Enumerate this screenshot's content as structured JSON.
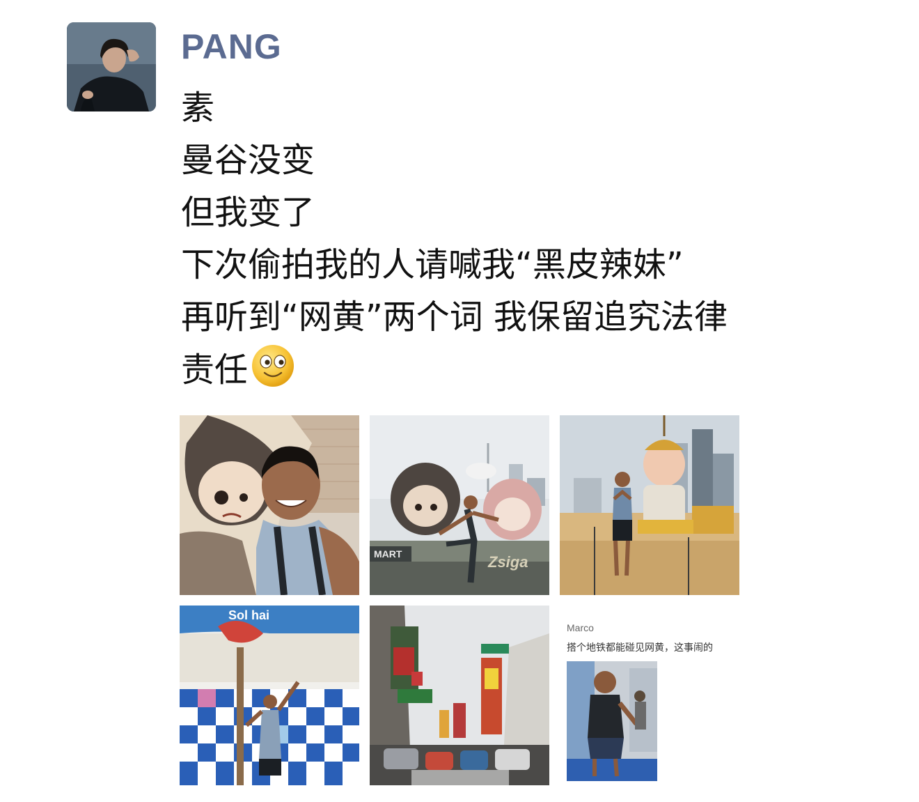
{
  "post": {
    "username": "PANG",
    "lines": [
      "素",
      "曼谷没变",
      "但我变了",
      "下次偷拍我的人请喊我“黑皮辣妹”",
      "再听到“网黄”两个词 我保留追究法律",
      "责任"
    ],
    "emoji": "smile-icon"
  },
  "photos": {
    "p6_caption_name": "Marco",
    "p6_caption_text": "搭个地铁都能碰见网黄，这事闹的",
    "p4_sign_text": "Sol hai",
    "p2_sign_text": "MART",
    "p2_sign_text2": "Zsiga"
  },
  "colors": {
    "username": "#5b6b91",
    "text": "#111111",
    "background": "#ffffff"
  }
}
